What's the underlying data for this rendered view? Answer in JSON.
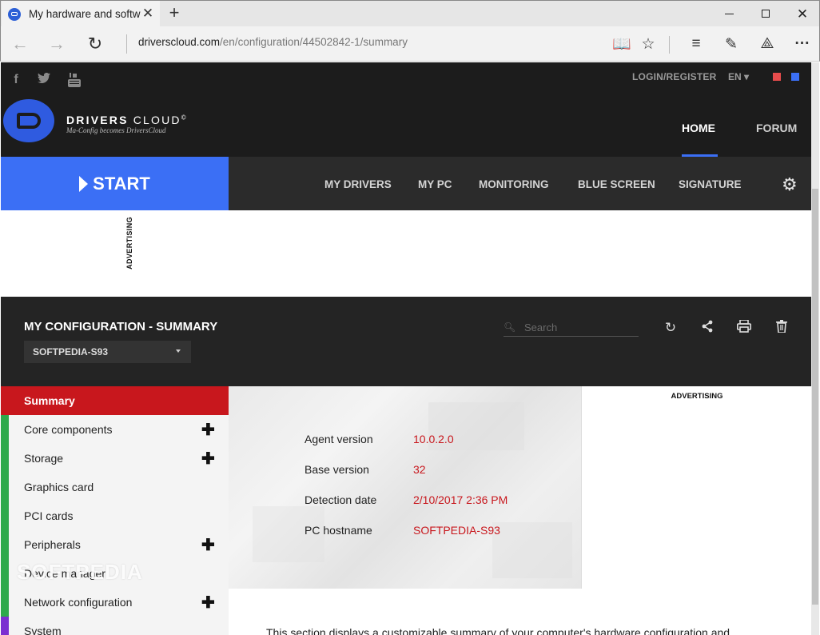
{
  "browser": {
    "tab_title": "My hardware and softw",
    "url_domain": "driverscloud.com",
    "url_path": "/en/configuration/44502842-1/summary"
  },
  "header": {
    "login_label": "LOGIN/REGISTER",
    "lang_label": "EN",
    "brand_bold": "DRIVERS",
    "brand_light": "CLOUD",
    "brand_mark": "©",
    "brand_sub": "Ma-Config becomes DriversCloud",
    "home_label": "HOME",
    "forum_label": "FORUM",
    "theme_colors": [
      "#e74c4c",
      "#3b6ff5"
    ]
  },
  "navbar": {
    "start_label": "START",
    "items": [
      "MY DRIVERS",
      "MY PC",
      "MONITORING",
      "BLUE SCREEN",
      "SIGNATURE"
    ]
  },
  "ads": {
    "top_label": "ADVERTISING",
    "right_label": "ADVERTISING"
  },
  "config": {
    "title": "MY CONFIGURATION - SUMMARY",
    "selected_pc": "SOFTPEDIA-S93",
    "search_placeholder": "Search"
  },
  "sidebar": {
    "items": [
      {
        "label": "Summary",
        "active": true,
        "expandable": false,
        "color": "#c8171d"
      },
      {
        "label": "Core components",
        "active": false,
        "expandable": true,
        "color": "#2eaa4c"
      },
      {
        "label": "Storage",
        "active": false,
        "expandable": true,
        "color": "#2eaa4c"
      },
      {
        "label": "Graphics card",
        "active": false,
        "expandable": false,
        "color": "#2eaa4c"
      },
      {
        "label": "PCI cards",
        "active": false,
        "expandable": false,
        "color": "#2eaa4c"
      },
      {
        "label": "Peripherals",
        "active": false,
        "expandable": true,
        "color": "#2eaa4c"
      },
      {
        "label": "Device manager",
        "active": false,
        "expandable": false,
        "color": "#2eaa4c"
      },
      {
        "label": "Network configuration",
        "active": false,
        "expandable": true,
        "color": "#2eaa4c"
      },
      {
        "label": "System",
        "active": false,
        "expandable": false,
        "color": "#7b2fd1"
      }
    ]
  },
  "summary": {
    "rows": [
      {
        "label": "Agent version",
        "value": "10.0.2.0"
      },
      {
        "label": "Base version",
        "value": "32"
      },
      {
        "label": "Detection date",
        "value": "2/10/2017 2:36 PM"
      },
      {
        "label": "PC hostname",
        "value": "SOFTPEDIA-S93"
      }
    ],
    "watermark": "SOFTPEDIA",
    "description": "This section displays a customizable summary of your computer's hardware configuration and"
  }
}
